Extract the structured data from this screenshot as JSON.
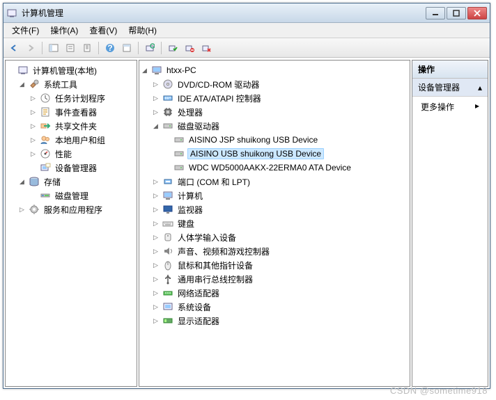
{
  "window": {
    "title": "计算机管理"
  },
  "menu": {
    "file": "文件(F)",
    "action": "操作(A)",
    "view": "查看(V)",
    "help": "帮助(H)"
  },
  "left_tree": {
    "root": "计算机管理(本地)",
    "system_tools": "系统工具",
    "task_scheduler": "任务计划程序",
    "event_viewer": "事件查看器",
    "shared_folders": "共享文件夹",
    "local_users": "本地用户和组",
    "performance": "性能",
    "device_manager": "设备管理器",
    "storage": "存储",
    "disk_mgmt": "磁盘管理",
    "services_apps": "服务和应用程序"
  },
  "center_tree": {
    "root": "htxx-PC",
    "dvd": "DVD/CD-ROM 驱动器",
    "ide": "IDE ATA/ATAPI 控制器",
    "cpu": "处理器",
    "disk_drives": "磁盘驱动器",
    "disk1": "AISINO JSP shuikong USB Device",
    "disk2": "AISINO USB shuikong USB Device",
    "disk3": "WDC WD5000AAKX-22ERMA0 ATA Device",
    "ports": "端口 (COM 和 LPT)",
    "computer": "计算机",
    "monitors": "监视器",
    "keyboards": "键盘",
    "hid": "人体学输入设备",
    "sound": "声音、视频和游戏控制器",
    "mice": "鼠标和其他指针设备",
    "usb": "通用串行总线控制器",
    "network": "网络适配器",
    "system": "系统设备",
    "display": "显示适配器"
  },
  "actions": {
    "header": "操作",
    "section": "设备管理器",
    "more": "更多操作"
  },
  "watermark": "CSDN @sometime918"
}
